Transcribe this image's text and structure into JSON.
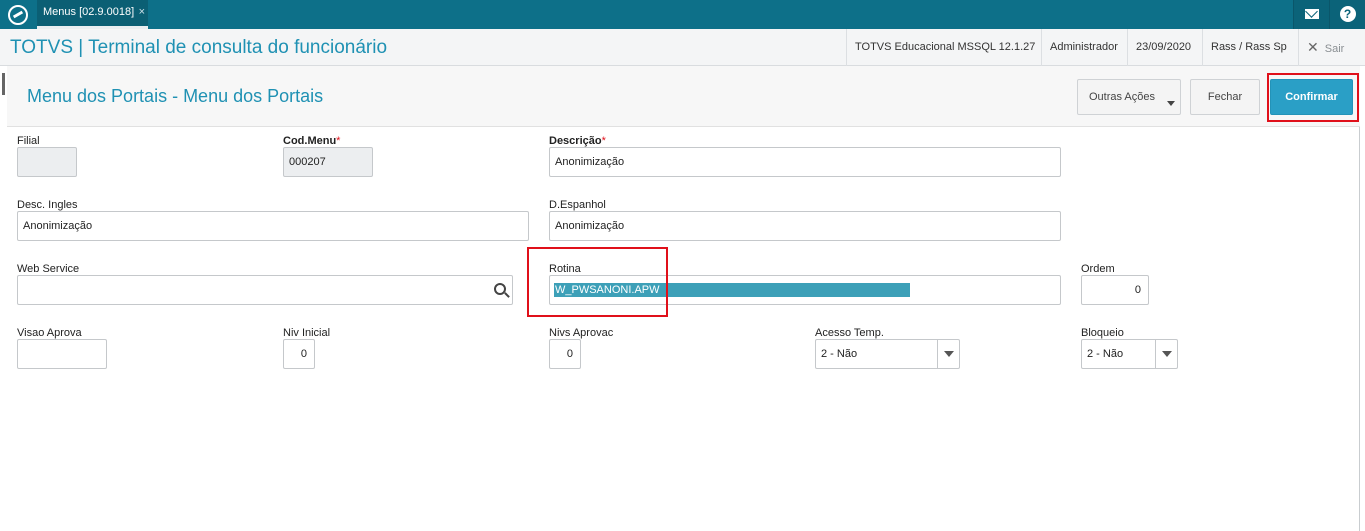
{
  "topbar": {
    "logo_icon": "totvs-logo-icon",
    "tab_label": "Menus [02.9.0018]",
    "tab_close": "×",
    "mail_icon": "mail-icon",
    "help_icon": "help-icon",
    "help_glyph": "?"
  },
  "appbar": {
    "title": "TOTVS | Terminal de consulta do funcionário",
    "environment": "TOTVS Educacional MSSQL 12.1.27",
    "user": "Administrador",
    "date": "23/09/2020",
    "branch": "Rass / Rass Sp",
    "exit_label": "Sair",
    "exit_glyph": "✕"
  },
  "page": {
    "title": "Menu dos Portais - Menu dos Portais",
    "actions": {
      "outras_label": "Outras Ações",
      "fechar_label": "Fechar",
      "confirmar_label": "Confirmar"
    },
    "accent_color": "#2a9fc6",
    "highlight_color": "#e0101a"
  },
  "form": {
    "filial": {
      "label": "Filial",
      "value": ""
    },
    "cod_menu": {
      "label": "Cod.Menu",
      "required": "*",
      "value": "000207"
    },
    "descricao": {
      "label": "Descrição",
      "required": "*",
      "value": "Anonimização"
    },
    "desc_ingles": {
      "label": "Desc. Ingles",
      "value": "Anonimização"
    },
    "d_espanhol": {
      "label": "D.Espanhol",
      "value": "Anonimização"
    },
    "web_service": {
      "label": "Web Service",
      "value": "",
      "icon": "search-icon"
    },
    "rotina": {
      "label": "Rotina",
      "value": "W_PWSANONI.APW"
    },
    "ordem": {
      "label": "Ordem",
      "value": "0"
    },
    "visao_aprova": {
      "label": "Visao Aprova",
      "value": ""
    },
    "niv_inicial": {
      "label": "Niv Inicial",
      "value": "0"
    },
    "nivs_aprovac": {
      "label": "Nivs Aprovac",
      "value": "0"
    },
    "acesso_temp": {
      "label": "Acesso Temp.",
      "value": "2 - Não"
    },
    "bloqueio": {
      "label": "Bloqueio",
      "value": "2 - Não"
    }
  }
}
